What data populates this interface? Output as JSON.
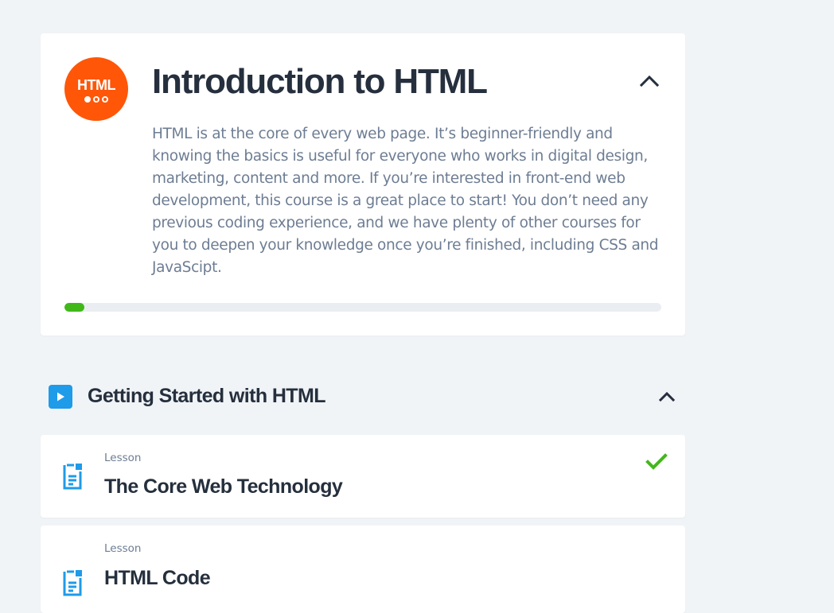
{
  "course": {
    "logo_text": "HTML",
    "title": "Introduction to HTML",
    "description": "HTML is at the core of every web page. It’s beginner-friendly and knowing the basics is useful for everyone who works in digital design, marketing, content and more. If you’re interested in front-end web development, this course is a great place to start! You don’t need any previous coding experience, and we have plenty of other courses for you to deepen your knowledge once you’re finished, including CSS and JavaScipt.",
    "progress_fraction": 0.033,
    "collapse_icon": "chevron-up-icon"
  },
  "section": {
    "title": "Getting Started with HTML",
    "icon": "play-icon",
    "collapse_icon": "chevron-up-icon"
  },
  "lessons": [
    {
      "type": "Lesson",
      "title": "The Core Web Technology",
      "icon": "lesson-document-icon",
      "completed": true,
      "status_icon": "checkmark-icon"
    },
    {
      "type": "Lesson",
      "title": "HTML Code",
      "icon": "lesson-document-icon",
      "completed": false
    }
  ],
  "colors": {
    "background": "#f1f4f7",
    "card": "#ffffff",
    "title": "#252f3d",
    "body_text": "#6d7d93",
    "html_logo": "#ff5608",
    "progress": "#41b81a",
    "progress_track": "#eaeef2",
    "section_icon": "#1e9be9",
    "lesson_icon": "#1e9be9",
    "completed_check": "#41b81a"
  }
}
